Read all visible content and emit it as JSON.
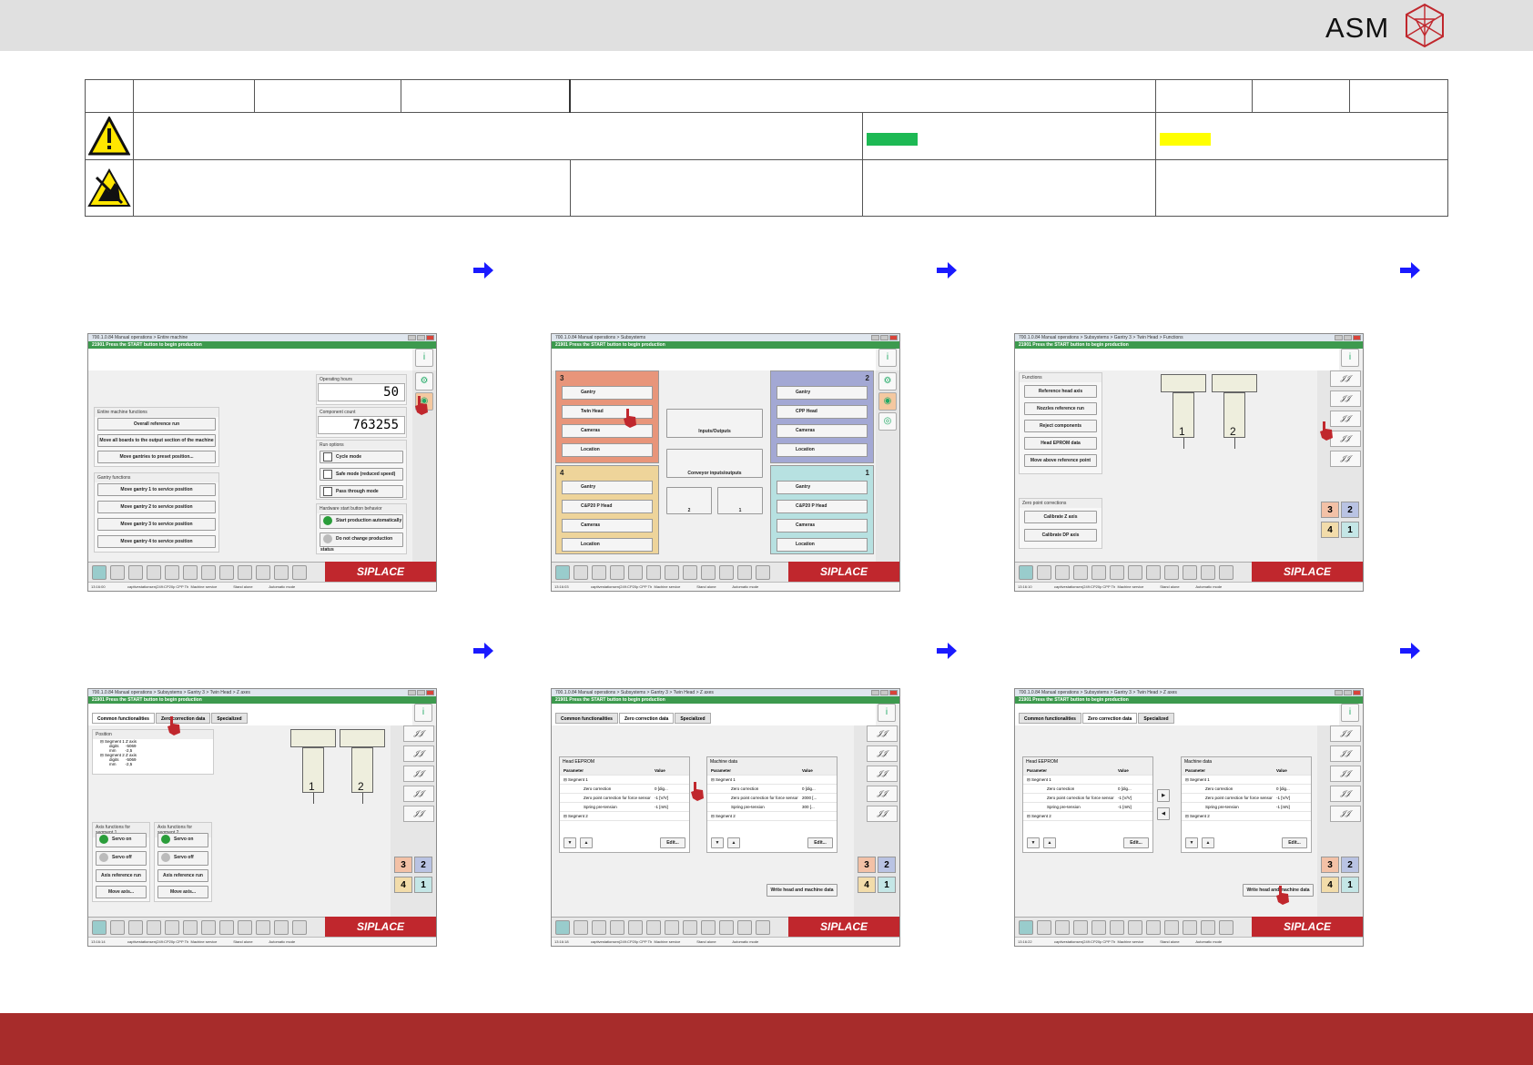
{
  "header": {
    "brand": "ASM",
    "right_mark": "siplace-hex-logo"
  },
  "footer": {
    "color": "#a72c2b"
  },
  "swatches": {
    "green": "#1db954",
    "yellow": "#ffff00"
  },
  "screens": {
    "s1": {
      "title": "700.1.0.84 Manual operations > Entire machine",
      "message": "21901 Press the START button to begin production",
      "operating_hours_label": "Operating hours",
      "operating_hours": "50",
      "component_count_label": "Component count",
      "component_count": "763255",
      "entire_label": "Entire machine functions",
      "entire": [
        "Overall reference run",
        "Move all boards to the output section of the machine",
        "Move gantries to preset position..."
      ],
      "gantry_label": "Gantry functions",
      "gantry": [
        "Move gantry 1 to service position",
        "Move gantry 2 to service position",
        "Move gantry 3 to service position",
        "Move gantry 4 to service position"
      ],
      "run_label": "Run options",
      "run": [
        "Cycle mode",
        "Safe mode (reduced speed)",
        "Pass through mode"
      ],
      "hw_label": "Hardware start button behavior",
      "hw": [
        "Start production automatically",
        "Do not change production status"
      ],
      "time": "13:16:00",
      "station": "captivestationsen(249:CP20p CPP Th",
      "mode": "Machine service",
      "stand": "Stand alone",
      "auto": "Automatic mode"
    },
    "s2": {
      "title": "700.1.0.84 Manual operations > Subsystems",
      "message": "21901 Press the START button to begin production",
      "tile3": {
        "num": "3",
        "items": [
          "Gantry",
          "Twin Head",
          "Cameras",
          "Location"
        ]
      },
      "tile2": {
        "num": "2",
        "items": [
          "Gantry",
          "CPP Head",
          "Cameras",
          "Location"
        ]
      },
      "tile4": {
        "num": "4",
        "items": [
          "Gantry",
          "C&P20 P Head",
          "Cameras",
          "Location"
        ]
      },
      "tile1": {
        "num": "1",
        "items": [
          "Gantry",
          "C&P20 P Head",
          "Cameras",
          "Location"
        ]
      },
      "io": "Inputs/Outputs",
      "conv": "Conveyor inputs/outputs",
      "c2": "2",
      "c1": "1",
      "time": "13:16:03",
      "station": "captivestationsen(249:CP20p CPP Th",
      "mode": "Machine service",
      "stand": "Stand alone",
      "auto": "Automatic mode"
    },
    "s3": {
      "title": "700.1.0.84 Manual operations > Subsystems > Gantry 3 > Twin Head > Functions",
      "message": "21901 Press the START button to begin production",
      "func_label": "Functions",
      "func": [
        "Reference head axis",
        "Nozzles reference run",
        "Reject components",
        "Head EPROM data",
        "Move above reference point"
      ],
      "zero_label": "Zero point corrections",
      "zero": [
        "Calibrate Z axis",
        "Calibrate DP axis"
      ],
      "seg1": "1",
      "seg2": "2",
      "g3": "3",
      "g2": "2",
      "g4": "4",
      "g1": "1",
      "time": "13:16:10",
      "station": "captivestationsen(249:CP20p CPP Th",
      "mode": "Machine service",
      "stand": "Stand alone",
      "auto": "Automatic mode"
    },
    "s4": {
      "title": "700.1.0.84 Manual operations > Subsystems > Gantry 3 > Twin Head > Z axes",
      "message": "21901 Press the START button to begin production",
      "tabs": [
        "Common functionalities",
        "Zero correction data",
        "Specialized"
      ],
      "pos_label": "Position",
      "pos_lines": [
        "Segment 1 Z axis",
        "digits",
        "mm",
        "Segment 2 Z axis",
        "digits",
        "mm"
      ],
      "pos_vals": [
        "",
        "-5069",
        "-2,5",
        "",
        "-5069",
        "-2,5"
      ],
      "ax1_label": "Axis functions for segment 1",
      "ax2_label": "Axis functions for segment 2",
      "servo_on": "Servo on",
      "servo_off": "Servo off",
      "axis_ref": "Axis reference run",
      "move_axis": "Move axis...",
      "seg1": "1",
      "seg2": "2",
      "g3": "3",
      "g2": "2",
      "g4": "4",
      "g1": "1",
      "time": "13:16:14",
      "station": "captivestationsen(249:CP20p CPP Th",
      "mode": "Machine service",
      "stand": "Stand alone",
      "auto": "Automatic mode"
    },
    "s5": {
      "title": "700.1.0.84 Manual operations > Subsystems > Gantry 3 > Twin Head > Z axes",
      "message": "21901 Press the START button to begin production",
      "tabs": [
        "Common functionalities",
        "Zero correction data",
        "Specialized"
      ],
      "head_label": "Head EEPROM",
      "mach_label": "Machine data",
      "col_param": "Parameter",
      "col_value": "Value",
      "rows": [
        "Segment 1",
        "Zero correction",
        "Zero point correction for force sensor",
        "Spring pre-tension",
        "Segment 2"
      ],
      "head_vals": [
        "",
        "0 [dig...",
        "-1 [V/V]",
        "-1 [mN]",
        ""
      ],
      "mach_vals": [
        "",
        "0 [dig...",
        "2000 [...",
        "300 [...",
        ""
      ],
      "edit": "Edit...",
      "write": "Write head and machine data",
      "g3": "3",
      "g2": "2",
      "g4": "4",
      "g1": "1",
      "time": "13:16:18",
      "station": "captivestationsen(249:CP20p CPP Th",
      "mode": "Machine service",
      "stand": "Stand alone",
      "auto": "Automatic mode"
    },
    "s6": {
      "title": "700.1.0.84 Manual operations > Subsystems > Gantry 3 > Twin Head > Z axes",
      "message": "21901 Press the START button to begin production",
      "tabs": [
        "Common functionalities",
        "Zero correction data",
        "Specialized"
      ],
      "head_label": "Head EEPROM",
      "mach_label": "Machine data",
      "col_param": "Parameter",
      "col_value": "Value",
      "rows": [
        "Segment 1",
        "Zero correction",
        "Zero point correction for force sensor",
        "Spring pre-tension",
        "Segment 2"
      ],
      "head_vals": [
        "",
        "0 [dig...",
        "-1 [V/V]",
        "-1 [mN]",
        ""
      ],
      "mach_vals": [
        "",
        "0 [dig...",
        "-1 [V/V]",
        "-1 [mN]",
        ""
      ],
      "edit": "Edit...",
      "write": "Write head and machine data",
      "g3": "3",
      "g2": "2",
      "g4": "4",
      "g1": "1",
      "time": "13:16:22",
      "station": "captivestationsen(249:CP20p CPP Th",
      "mode": "Machine service",
      "stand": "Stand alone",
      "auto": "Automatic mode"
    }
  }
}
